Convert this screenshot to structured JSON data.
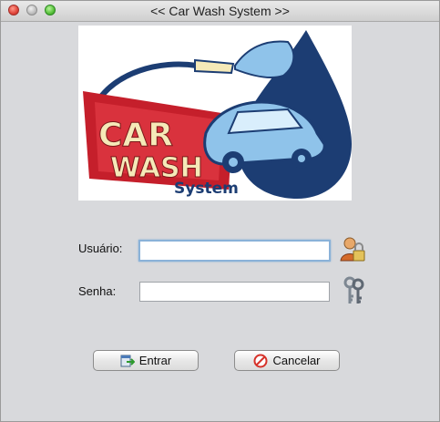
{
  "window": {
    "title": "<< Car Wash System >>"
  },
  "logo": {
    "word1": "CAR",
    "word2": "WASH",
    "word3": "System"
  },
  "form": {
    "username_label": "Usuário:",
    "username_value": "",
    "password_label": "Senha:",
    "password_value": ""
  },
  "buttons": {
    "login": "Entrar",
    "cancel": "Cancelar"
  },
  "icons": {
    "user": "user-lock-icon",
    "password": "keys-icon",
    "login": "enter-icon",
    "cancel": "cancel-icon"
  },
  "colors": {
    "banner_red": "#c51f2b",
    "drop_blue": "#1c3d73",
    "car_blue": "#8fc3ea"
  }
}
